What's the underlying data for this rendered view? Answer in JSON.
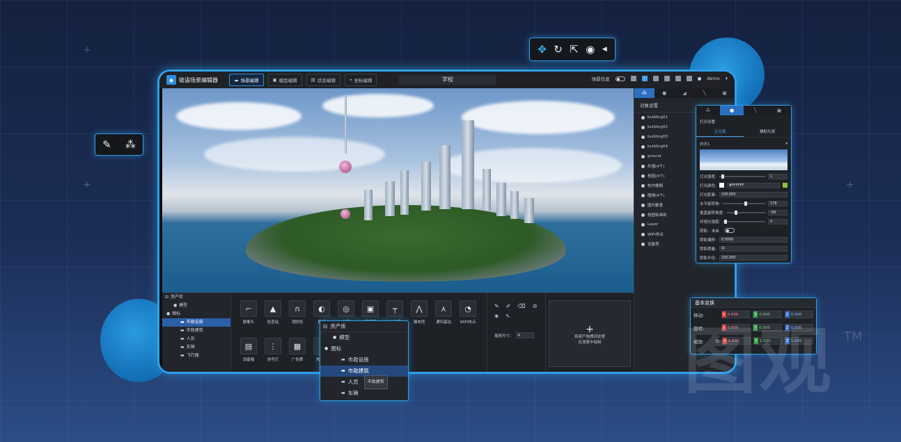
{
  "app": {
    "title": "链语场景编辑器",
    "scene_name": "学校",
    "tabs": [
      {
        "label": "场景编辑",
        "active": true
      },
      {
        "label": "模型编辑",
        "active": false
      },
      {
        "label": "状态编辑",
        "active": false
      },
      {
        "label": "坐标编辑",
        "active": false
      }
    ],
    "scene_info_label": "场景信息",
    "user": "demo"
  },
  "float_toolbar": {
    "icons": [
      "move-icon",
      "rotate-icon",
      "scale-icon",
      "place-icon"
    ]
  },
  "right_panel": {
    "title": "对象设置",
    "objects": [
      "building01",
      "building02",
      "building03",
      "building04",
      "ground",
      "外围(4个)",
      "校园(4个)",
      "校内楼阁",
      "围墙(4个)",
      "国内紫竖",
      "校园标准树",
      "Layer",
      "WIFI热点",
      "设备塔"
    ]
  },
  "asset_tree": {
    "title": "资产库",
    "items": [
      {
        "label": "模型",
        "indent": 1
      },
      {
        "label": "图标",
        "indent": 0
      },
      {
        "label": "市政设施",
        "indent": 2,
        "selected": true
      },
      {
        "label": "市政建筑",
        "indent": 2
      },
      {
        "label": "人员",
        "indent": 2
      },
      {
        "label": "车辆",
        "indent": 2
      },
      {
        "label": "飞行器",
        "indent": 2
      }
    ]
  },
  "assets": {
    "row1": [
      "摄像头",
      "检查站",
      "消防栓",
      "路灯",
      "井盖",
      "传感器",
      "电线杆",
      "输电塔",
      "通讯基站",
      "WIFI热点"
    ],
    "row2": [
      "设备箱",
      "信号灯",
      "广告牌",
      "充电桩"
    ]
  },
  "brush": {
    "size_label": "笔刷尺寸：",
    "size_value": "4"
  },
  "drop_zone": {
    "plus": "+",
    "line1": "将资产拖拽到这里",
    "line2": "在场景中绘制"
  },
  "light_panel": {
    "title": "灯光设置",
    "tabs": [
      "主光源",
      "辅助光源"
    ],
    "preset": "白天1",
    "rows": [
      {
        "label": "灯光强度:",
        "value": "1"
      },
      {
        "label": "灯光颜色:",
        "value": "#FFFFFF"
      },
      {
        "label": "灯光距离:",
        "value": "100.000"
      },
      {
        "label": "水平旋转角:",
        "value": "176"
      },
      {
        "label": "垂直旋转角度:",
        "value": "-58"
      },
      {
        "label": "环境光强度:",
        "value": "0"
      },
      {
        "label": "阴影:",
        "value": "未启"
      },
      {
        "label": "阴影偏移:",
        "value": "0.0000"
      },
      {
        "label": "阴影质量:",
        "value": "中"
      },
      {
        "label": "阴影半径:",
        "value": "100.000"
      }
    ],
    "colors": {
      "accent": "#2b6fc0",
      "swatch": "#8fc43a"
    }
  },
  "transform_panel": {
    "title": "基本变换",
    "rows": [
      {
        "label": "移动:",
        "x": "0.000",
        "y": "0.000",
        "z": "0.000"
      },
      {
        "label": "旋转:",
        "x": "0.000",
        "y": "0.000",
        "z": "0.000"
      },
      {
        "label": "缩放:",
        "x": "1.000",
        "y": "1.000",
        "z": "1.000"
      }
    ],
    "colors": {
      "x": "#d93b3b",
      "y": "#3aa64a",
      "z": "#2d6fd0"
    }
  },
  "lib_float": {
    "title": "资产库",
    "items": [
      "模型",
      "图标",
      "市政设施",
      "市政建筑",
      "人员",
      "车辆"
    ],
    "tooltip": "市政建筑"
  },
  "watermark": {
    "text": "图观",
    "tm": "TM"
  }
}
